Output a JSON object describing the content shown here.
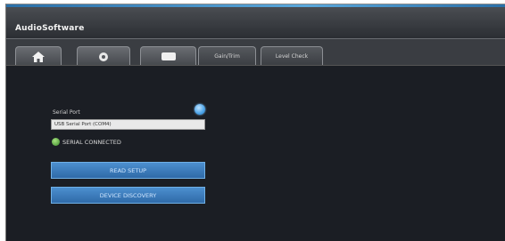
{
  "app": {
    "title": "AudioSoftware"
  },
  "tabs": [
    {
      "icon": "home-icon"
    },
    {
      "icon": "settings-icon"
    },
    {
      "icon": "device-icon"
    },
    {
      "label": "Gain/Trim"
    },
    {
      "label": "Level Check"
    }
  ],
  "serial": {
    "port_label": "Serial Port",
    "port_value": "USB Serial Port (COM4)",
    "status": "SERIAL CONNECTED",
    "status_color": "#4caf3a"
  },
  "buttons": {
    "primary": "READ SETUP",
    "secondary": "DEVICE DISCOVERY"
  },
  "colors": {
    "accent": "#3a80c6",
    "background": "#1b1e24"
  }
}
